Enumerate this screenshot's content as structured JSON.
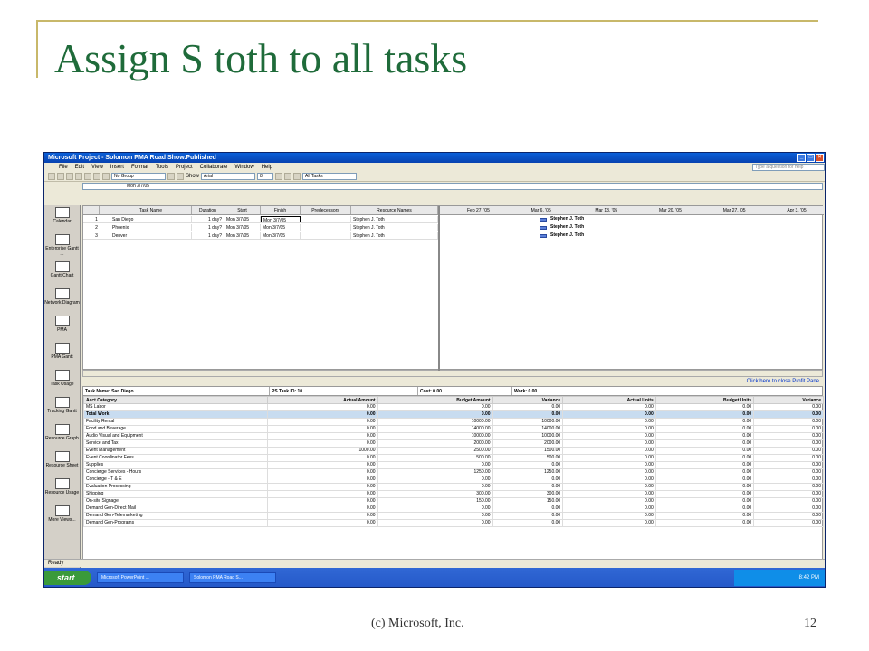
{
  "slide": {
    "title": "Assign S toth to all tasks",
    "footer_left": "(c) Microsoft, Inc.",
    "footer_right": "12"
  },
  "window": {
    "title": "Microsoft Project - Solomon PMA Road Show.Published",
    "menu": [
      "File",
      "Edit",
      "View",
      "Insert",
      "Format",
      "Tools",
      "Project",
      "Collaborate",
      "Window",
      "Help"
    ],
    "help_placeholder": "Type a question for help",
    "group_combo": "No Group",
    "show_label": "Show",
    "font_combo": "Arial",
    "size_combo": "8",
    "filter_combo": "All Tasks",
    "entry_value": "Mon 3/7/05"
  },
  "view_bar": [
    "Calendar",
    "Enterprise Gantt ...",
    "Gantt Chart",
    "Network Diagram",
    "PMA",
    "PMA Gantt",
    "Task Usage",
    "Tracking Gantt",
    "Resource Graph",
    "Resource Sheet",
    "Resource Usage",
    "More Views..."
  ],
  "task_table": {
    "headers": [
      "",
      "Task Name",
      "Duration",
      "Start",
      "Finish",
      "Predecessors",
      "Resource Names"
    ],
    "rows": [
      {
        "id": "1",
        "name": "San Diego",
        "duration": "1 day?",
        "start": "Mon 3/7/05",
        "finish": "Mon 3/7/05",
        "pred": "",
        "resource": "Stephen J. Toth"
      },
      {
        "id": "2",
        "name": "Phoenix",
        "duration": "1 day?",
        "start": "Mon 3/7/05",
        "finish": "Mon 3/7/05",
        "pred": "",
        "resource": "Stephen J. Toth"
      },
      {
        "id": "3",
        "name": "Denver",
        "duration": "1 day?",
        "start": "Mon 3/7/05",
        "finish": "Mon 3/7/05",
        "pred": "",
        "resource": "Stephen J. Toth"
      }
    ]
  },
  "gantt": {
    "weeks": [
      "Feb 27, '05",
      "Mar 6, '05",
      "Mar 13, '05",
      "Mar 20, '05",
      "Mar 27, '05",
      "Apr 3, '05"
    ],
    "bar_label": "Stephen J. Toth"
  },
  "profit_pane": {
    "close_link": "Click here to close Profit Pane",
    "task_name": "Task Name: San Diego",
    "ps_task_id": "PS Task ID: 10",
    "cost": "Cost: 0.00",
    "work": "Work: 0.00",
    "headers": [
      "Acct Category",
      "Actual Amount",
      "Budget Amount",
      "Variance",
      "Actual Units",
      "Budget Units",
      "Variance"
    ],
    "rows": [
      [
        "MS Labor",
        "0.00",
        "0.00",
        "0.00",
        "0.00",
        "0.00",
        "0.00"
      ],
      [
        "Total Work",
        "0.00",
        "0.00",
        "0.00",
        "0.00",
        "0.00",
        "0.00"
      ],
      [
        "Facility Rental",
        "0.00",
        "10000.00",
        "10000.00",
        "0.00",
        "0.00",
        "0.00"
      ],
      [
        "Food and Beverage",
        "0.00",
        "14000.00",
        "14000.00",
        "0.00",
        "0.00",
        "0.00"
      ],
      [
        "Audio Visual and Equipment",
        "0.00",
        "10000.00",
        "10000.00",
        "0.00",
        "0.00",
        "0.00"
      ],
      [
        "Service and Tax",
        "0.00",
        "2000.00",
        "2000.00",
        "0.00",
        "0.00",
        "0.00"
      ],
      [
        "Event Management",
        "1000.00",
        "2500.00",
        "1500.00",
        "0.00",
        "0.00",
        "0.00"
      ],
      [
        "Event Coordinator Fees",
        "0.00",
        "500.00",
        "500.00",
        "0.00",
        "0.00",
        "0.00"
      ],
      [
        "Supplies",
        "0.00",
        "0.00",
        "0.00",
        "0.00",
        "0.00",
        "0.00"
      ],
      [
        "Concierge Services - Hours",
        "0.00",
        "1250.00",
        "1250.00",
        "0.00",
        "0.00",
        "0.00"
      ],
      [
        "Concierge - T & E",
        "0.00",
        "0.00",
        "0.00",
        "0.00",
        "0.00",
        "0.00"
      ],
      [
        "Evaluation Processing",
        "0.00",
        "0.00",
        "0.00",
        "0.00",
        "0.00",
        "0.00"
      ],
      [
        "Shipping",
        "0.00",
        "300.00",
        "300.00",
        "0.00",
        "0.00",
        "0.00"
      ],
      [
        "On-site Signage",
        "0.00",
        "150.00",
        "150.00",
        "0.00",
        "0.00",
        "0.00"
      ],
      [
        "Demand Gen-Direct Mail",
        "0.00",
        "0.00",
        "0.00",
        "0.00",
        "0.00",
        "0.00"
      ],
      [
        "Demand Gen-Telemarketing",
        "0.00",
        "0.00",
        "0.00",
        "0.00",
        "0.00",
        "0.00"
      ],
      [
        "Demand Gen-Programs",
        "0.00",
        "0.00",
        "0.00",
        "0.00",
        "0.00",
        "0.00"
      ]
    ]
  },
  "status": "Ready",
  "taskbar": {
    "start": "start",
    "tasks": [
      "Microsoft PowerPoint ...",
      "Solomon PMA Road S..."
    ],
    "clock": "8:42 PM"
  }
}
